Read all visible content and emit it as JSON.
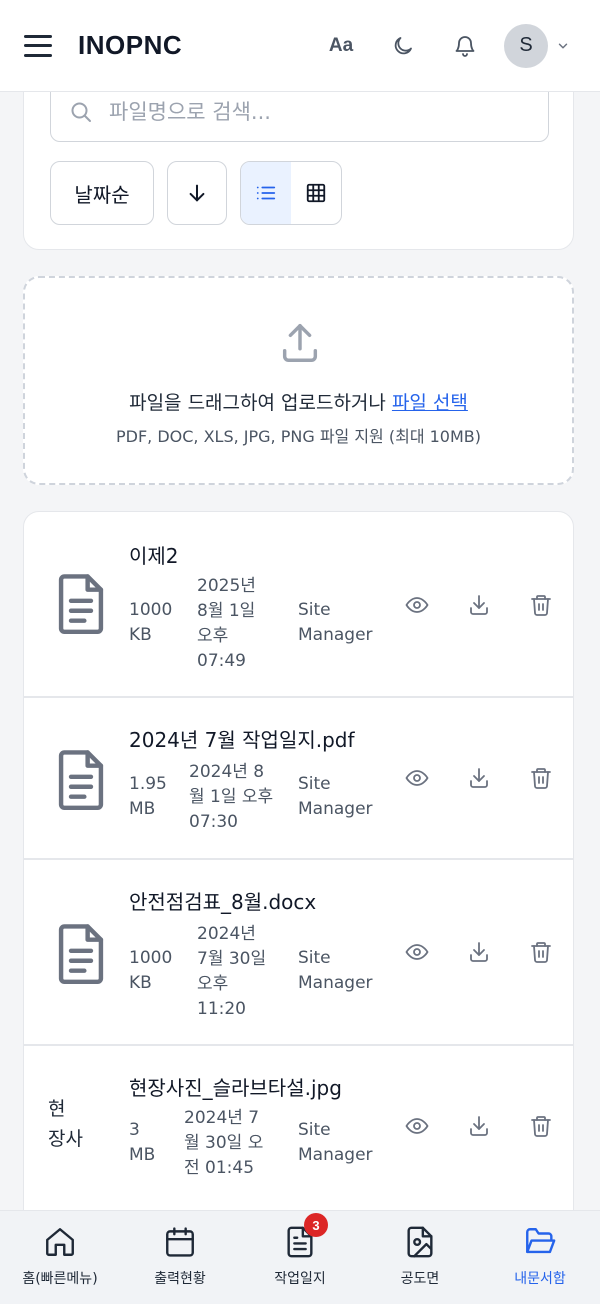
{
  "header": {
    "brand": "INOPNC",
    "font_size_label": "Aa",
    "avatar_initial": "S"
  },
  "search": {
    "placeholder": "파일명으로 검색..."
  },
  "filters": {
    "sort_label": "날짜순"
  },
  "upload": {
    "prompt": "파일을 드래그하여 업로드하거나 ",
    "link_label": "파일 선택",
    "hint": "PDF, DOC, XLS, JPG, PNG 파일 지원 (최대 10MB)"
  },
  "files": [
    {
      "name": "이제2",
      "size": [
        "1000",
        "KB"
      ],
      "date": [
        "2025년",
        "8월 1일",
        "오후",
        "07:49"
      ],
      "uploader": [
        "Site",
        "Manager"
      ]
    },
    {
      "name": "2024년 7월 작업일지.pdf",
      "size": [
        "1.95",
        "MB"
      ],
      "date": [
        "2024년 8",
        "월 1일 오후",
        "07:30"
      ],
      "uploader": [
        "Site",
        "Manager"
      ]
    },
    {
      "name": "안전점검표_8월.docx",
      "size": [
        "1000",
        "KB"
      ],
      "date": [
        "2024년",
        "7월 30일",
        "오후",
        "11:20"
      ],
      "uploader": [
        "Site",
        "Manager"
      ]
    },
    {
      "name": "현장사진_슬라브타설.jpg",
      "thumb_alt": [
        "현",
        "장사"
      ],
      "size": [
        "3",
        "MB"
      ],
      "date": [
        "2024년 7",
        "월 30일 오",
        "전 01:45"
      ],
      "uploader": [
        "Site",
        "Manager"
      ]
    }
  ],
  "nav": {
    "items": [
      {
        "label": "홈(빠른메뉴)"
      },
      {
        "label": "출력현황"
      },
      {
        "label": "작업일지",
        "badge": "3"
      },
      {
        "label": "공도면"
      },
      {
        "label": "내문서함"
      }
    ]
  },
  "colors": {
    "accent": "#2563eb",
    "badge": "#dc2626",
    "icon_gray": "#6b7280"
  }
}
